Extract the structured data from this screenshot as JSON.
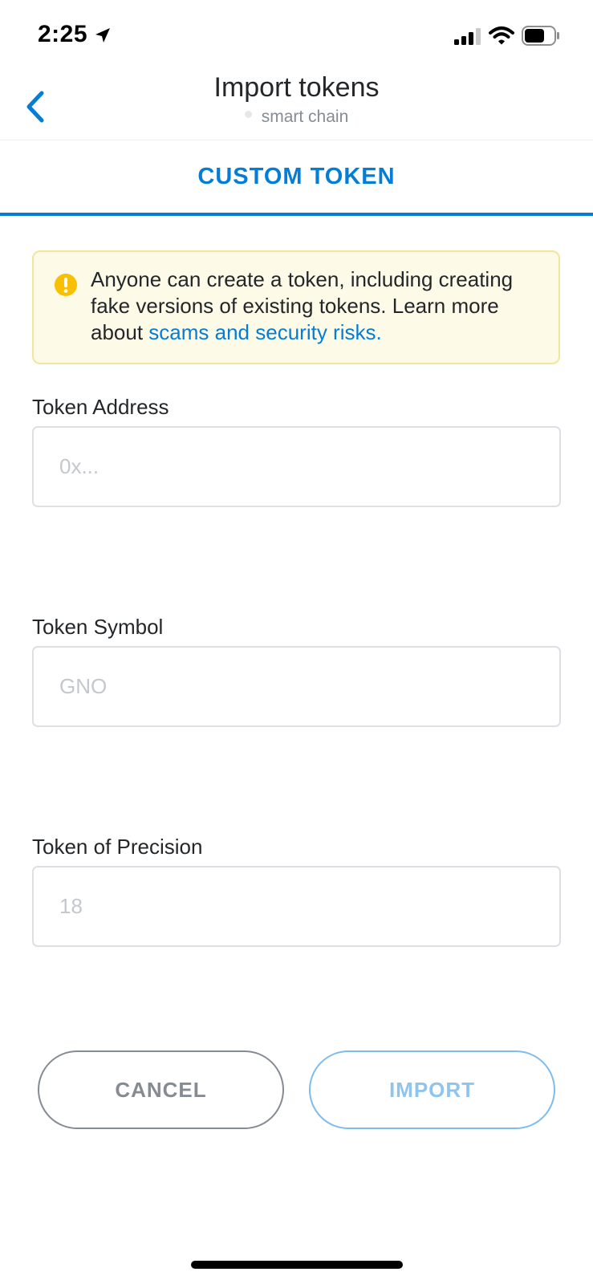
{
  "status_bar": {
    "time": "2:25",
    "icons": [
      "location-arrow-icon",
      "signal-icon",
      "wifi-icon",
      "battery-icon"
    ]
  },
  "header": {
    "title": "Import tokens",
    "network": "smart chain",
    "back_icon": "chevron-left-icon"
  },
  "tab": {
    "label": "CUSTOM TOKEN"
  },
  "warning": {
    "icon": "exclamation-circle-icon",
    "text": "Anyone can create a token, including creating fake versions of existing tokens. Learn more about ",
    "link": "scams and security risks."
  },
  "fields": [
    {
      "label": "Token Address",
      "value": "",
      "placeholder": "0x..."
    },
    {
      "label": "Token Symbol",
      "value": "",
      "placeholder": "GNO"
    },
    {
      "label": "Token of Precision",
      "value": "",
      "placeholder": "18"
    }
  ],
  "buttons": {
    "cancel": "CANCEL",
    "import": "IMPORT"
  },
  "colors": {
    "accent": "#037dd6",
    "warning_bg": "#fefae8",
    "warning_border": "#f5e49b",
    "warning_icon": "#f8c000",
    "import_disabled": "#8ec4ee",
    "cancel": "#858b93"
  }
}
